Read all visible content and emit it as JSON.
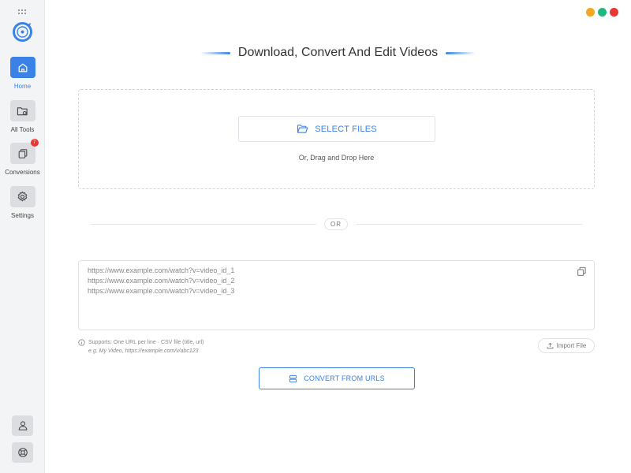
{
  "window": {
    "title": "Download, Convert And Edit Videos",
    "controls": [
      {
        "name": "minimize",
        "color": "#f5a623"
      },
      {
        "name": "maximize",
        "color": "#1eb980"
      },
      {
        "name": "close",
        "color": "#e53935"
      }
    ]
  },
  "sidebar": {
    "items": [
      {
        "label": "Home",
        "icon": "home-icon",
        "active": true
      },
      {
        "label": "All Tools",
        "icon": "folder-gear-icon",
        "active": false
      },
      {
        "label": "Conversions",
        "icon": "copy-icon",
        "active": false,
        "badge": "7"
      },
      {
        "label": "Settings",
        "icon": "gear-icon",
        "active": false
      }
    ],
    "bottom": [
      {
        "icon": "user-icon",
        "name": "account"
      },
      {
        "icon": "support-icon",
        "name": "help"
      }
    ]
  },
  "upload": {
    "select_label": "SELECT FILES",
    "drag_text": "Or, Drag and Drop Here"
  },
  "divider": {
    "label": "OR"
  },
  "urls": {
    "placeholder_lines": [
      "https://www.example.com/watch?v=video_id_1",
      "https://www.example.com/watch?v=video_id_2",
      "https://www.example.com/watch?v=video_id_3"
    ],
    "support_text": "Supports: One URL per line · CSV file (title, url)",
    "example_text": "e.g. My Video, https://example.com/v/abc123",
    "import_label": "Import File",
    "convert_label": "CONVERT FROM URLS"
  },
  "colors": {
    "accent": "#3b82e6",
    "badge": "#e53935"
  }
}
